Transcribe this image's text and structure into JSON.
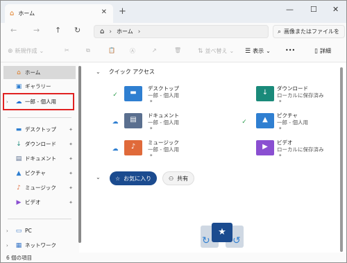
{
  "tab": {
    "title": "ホーム",
    "close": "✕",
    "new_tab": "+"
  },
  "window_controls": {
    "minimize": "—",
    "maximize": "☐",
    "close": "✕"
  },
  "nav": {
    "back": "←",
    "forward": "→",
    "up": "↑",
    "refresh": "↻"
  },
  "address": {
    "home_glyph": "⌂",
    "sep1": "›",
    "location": "ホーム",
    "sep2": "›"
  },
  "search": {
    "placeholder": "画像またはファイルを"
  },
  "toolbar": {
    "new_label": "新規作成",
    "cut": "✂",
    "copy": "⧉",
    "paste": "📋",
    "rename": "Ⓐ",
    "share": "↗",
    "delete": "🗑",
    "sort_label": "並べ替え",
    "view_label": "表示",
    "more": "•••",
    "details_label": "詳細"
  },
  "sidebar": {
    "items": [
      {
        "label": "ホーム"
      },
      {
        "label": "ギャラリー"
      },
      {
        "label": "一郎 - 個人用"
      },
      {
        "label": "デスクトップ"
      },
      {
        "label": "ダウンロード"
      },
      {
        "label": "ドキュメント"
      },
      {
        "label": "ピクチャ"
      },
      {
        "label": "ミュージック"
      },
      {
        "label": "ビデオ"
      },
      {
        "label": "PC"
      },
      {
        "label": "ネットワーク"
      }
    ]
  },
  "main": {
    "quick_access_title": "クイック アクセス",
    "quick_items": [
      {
        "name": "デスクトップ",
        "sub": "一郎 - 個人用"
      },
      {
        "name": "ダウンロード",
        "sub": "ローカルに保存済み"
      },
      {
        "name": "ドキュメント",
        "sub": "一郎 - 個人用"
      },
      {
        "name": "ピクチャ",
        "sub": "一郎 - 個人用"
      },
      {
        "name": "ミュージック",
        "sub": "一郎 - 個人用"
      },
      {
        "name": "ビデオ",
        "sub": "ローカルに保存済み"
      }
    ],
    "favorites_chip": "お気に入り",
    "shared_chip": "共有"
  },
  "status": {
    "count": "6 個の項目"
  },
  "colors": {
    "accent": "#1b4b8f",
    "highlight": "#e02020",
    "folder_blue": "#2f7fd1",
    "folder_teal": "#1a8a7a"
  }
}
